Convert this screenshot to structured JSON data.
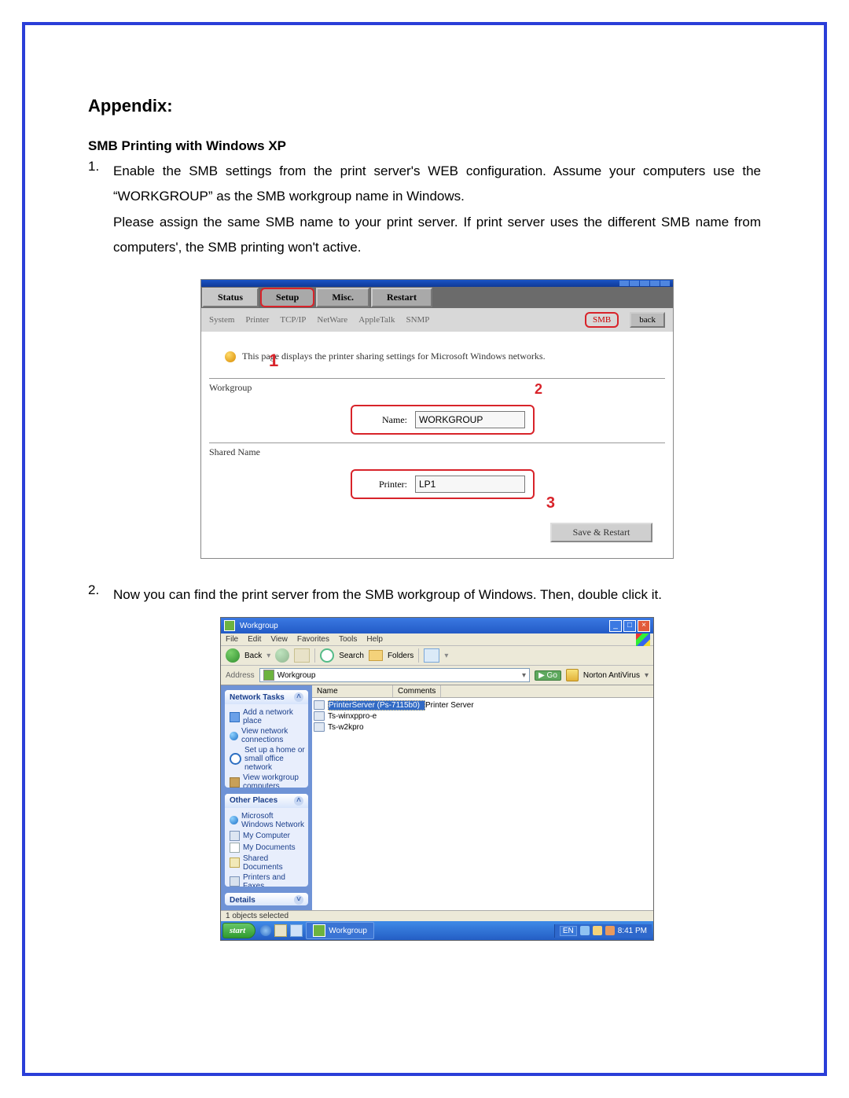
{
  "appendix_heading": "Appendix:",
  "subheading": "SMB Printing with Windows XP",
  "steps": [
    {
      "num": "1.",
      "text_line1": "Enable the SMB settings from the print server's WEB configuration. Assume your computers use the “WORKGROUP” as the SMB workgroup name in Windows.",
      "text_line2": "Please assign the same SMB name to your print server. If print server uses the different SMB name from computers', the SMB printing won't active."
    },
    {
      "num": "2.",
      "text_line1": "Now you can find the print server from the SMB workgroup of Windows. Then, double click it."
    }
  ],
  "screenshot1": {
    "main_tabs": {
      "status": "Status",
      "setup": "Setup",
      "misc": "Misc.",
      "restart": "Restart"
    },
    "sub_tabs": {
      "system": "System",
      "printer": "Printer",
      "tcpip": "TCP/IP",
      "netware": "NetWare",
      "appletalk": "AppleTalk",
      "snmp": "SNMP",
      "smb": "SMB",
      "back": "back"
    },
    "marks": {
      "one": "1",
      "two": "2",
      "three": "3"
    },
    "info_text": "This page displays the printer sharing settings for Microsoft Windows networks.",
    "sections": {
      "workgroup": "Workgroup",
      "shared_name": "Shared Name"
    },
    "fields": {
      "name_label": "Name:",
      "name_value": "WORKGROUP",
      "printer_label": "Printer:",
      "printer_value": "LP1"
    },
    "save_button": "Save & Restart"
  },
  "screenshot2": {
    "title": "Workgroup",
    "window_buttons": {
      "min": "_",
      "max": "□",
      "close": "×"
    },
    "menu": [
      "File",
      "Edit",
      "View",
      "Favorites",
      "Tools",
      "Help"
    ],
    "toolbar": {
      "back": "Back",
      "search": "Search",
      "folders": "Folders"
    },
    "address": {
      "label": "Address",
      "value": "Workgroup",
      "go": "Go",
      "norton": "Norton AntiVirus"
    },
    "side_panels": {
      "network_tasks": {
        "title": "Network Tasks",
        "items": [
          "Add a network place",
          "View network connections",
          "Set up a home or small office network",
          "View workgroup computers"
        ]
      },
      "other_places": {
        "title": "Other Places",
        "items": [
          "Microsoft Windows Network",
          "My Computer",
          "My Documents",
          "Shared Documents",
          "Printers and Faxes"
        ]
      },
      "details": {
        "title": "Details"
      }
    },
    "list": {
      "headers": {
        "name": "Name",
        "comments": "Comments"
      },
      "rows": [
        {
          "name": "PrinterServer (Ps-7115b0)",
          "comments": "Printer Server",
          "selected": true
        },
        {
          "name": "Ts-winxppro-e",
          "comments": "",
          "selected": false
        },
        {
          "name": "Ts-w2kpro",
          "comments": "",
          "selected": false
        }
      ]
    },
    "status_bar": "1 objects selected",
    "taskbar": {
      "start": "start",
      "active_task": "Workgroup",
      "lang": "EN",
      "clock": "8:41 PM"
    }
  }
}
